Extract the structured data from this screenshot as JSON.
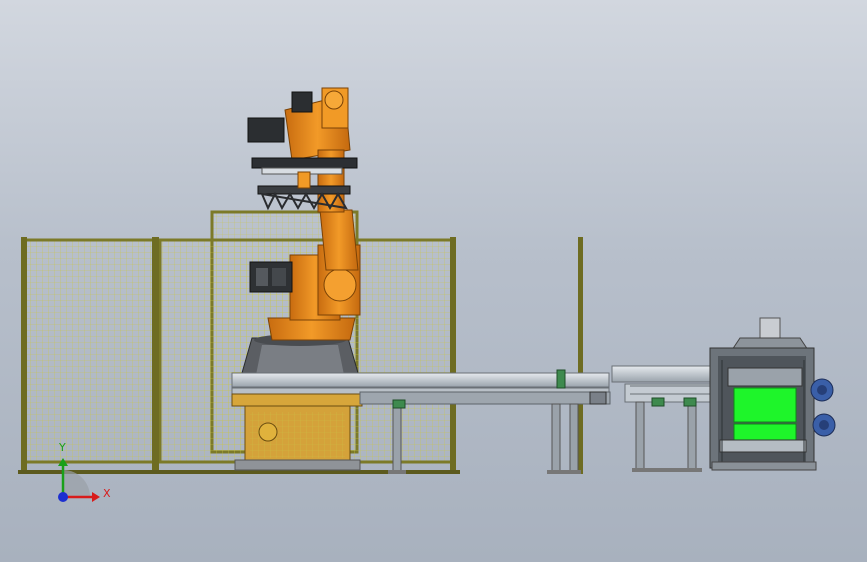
{
  "triad": {
    "x_label": "X",
    "y_label": "Y",
    "x_color": "#d81b1b",
    "y_color": "#19a019",
    "z_color": "#1c2fd0"
  },
  "colors": {
    "robot": "#e98a1a",
    "fence_frame": "#7c7a28",
    "fence_mesh": "#c9c648",
    "conveyor": "#c7cdd3",
    "product": "#1ef52a",
    "motor": "#3a5fa8"
  }
}
